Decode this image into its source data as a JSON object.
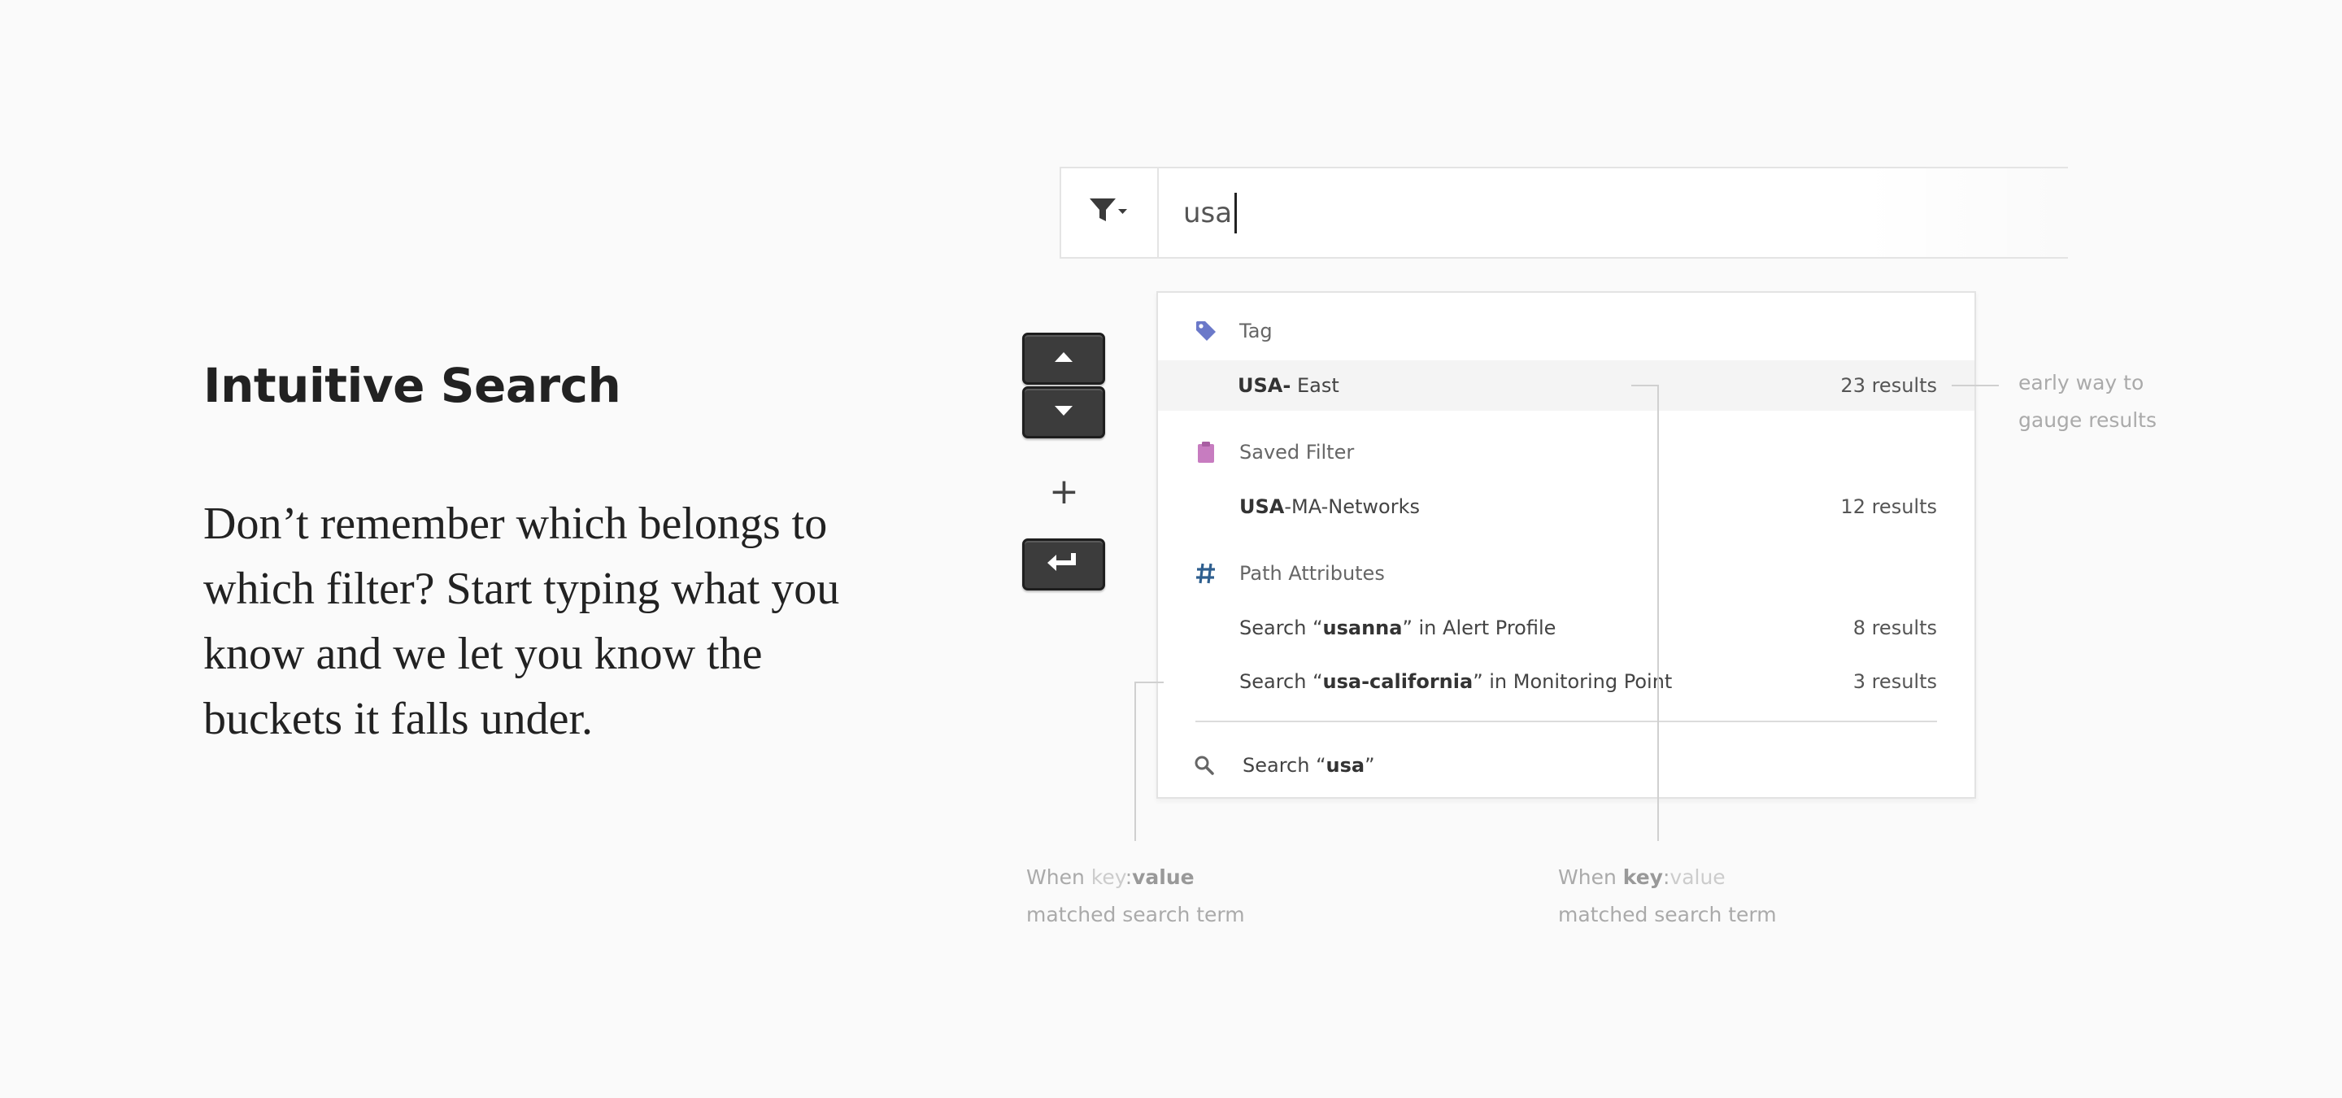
{
  "hero": {
    "title": "Intuitive Search",
    "body": "Don’t remember which belongs to which filter? Start typing what you know and we let you know the buckets it falls under."
  },
  "search": {
    "query": "usa",
    "filter_icon": "filter-dropdown-icon"
  },
  "keys": {
    "up_icon": "arrow-up-icon",
    "down_icon": "arrow-down-icon",
    "plus": "+",
    "enter_icon": "enter-key-icon"
  },
  "dropdown": {
    "groups": [
      {
        "label": "Tag",
        "icon": "tag-icon",
        "icon_color": "#6b79c9",
        "items": [
          {
            "match": "USA-",
            "rest": " East",
            "count": "23 results",
            "highlighted": true
          }
        ]
      },
      {
        "label": "Saved Filter",
        "icon": "clipboard-icon",
        "icon_color": "#c77cc0",
        "items": [
          {
            "match": "USA",
            "rest": "-MA-Networks",
            "count": "12 results"
          }
        ]
      },
      {
        "label": "Path Attributes",
        "icon": "hash-icon",
        "icon_color": "#2f5f8f",
        "items": [
          {
            "pre": "Search “",
            "match": "usanna",
            "rest": "” in Alert Profile",
            "count": "8 results"
          },
          {
            "pre": "Search “",
            "match": "usa-california",
            "rest": "” in Monitoring Point",
            "count": "3 results"
          }
        ]
      }
    ],
    "search_all": {
      "pre": "Search “",
      "match": "usa",
      "post": "”",
      "icon": "search-icon"
    }
  },
  "annotations": {
    "results_note": {
      "line1": "early way to",
      "line2": "gauge results"
    },
    "value_note": {
      "prefix": "When ",
      "key": "key",
      "sep": ":",
      "value": "value",
      "line2": "matched search term"
    },
    "key_note": {
      "prefix": "When ",
      "key": "key",
      "sep": ":",
      "value": "value",
      "line2": "matched search term"
    }
  }
}
